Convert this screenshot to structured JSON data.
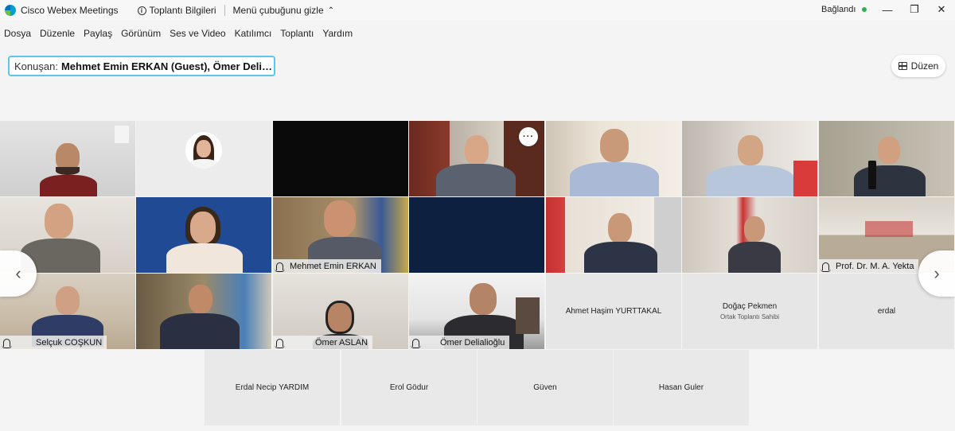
{
  "window": {
    "app_title": "Cisco Webex Meetings",
    "meeting_info": "Toplantı Bilgileri",
    "hide_menu": "Menü çubuğunu gizle",
    "status": "Bağlandı",
    "status_color": "#2bb24c"
  },
  "menu": [
    "Dosya",
    "Düzenle",
    "Paylaş",
    "Görünüm",
    "Ses ve Video",
    "Katılımcı",
    "Toplantı",
    "Yardım"
  ],
  "speaker": {
    "label": "Konuşan:",
    "names": "Mehmet Emin ERKAN (Guest), Ömer Delia..."
  },
  "layout_button": "Düzen",
  "participants": {
    "mehmet": "Mehmet Emin ERKAN",
    "yektai": "Prof. Dr. M. A. Yekta",
    "selcuk": "Selçuk COŞKUN",
    "omer_aslan": "Ömer ASLAN",
    "omer_d": "Ömer Delialioğlu",
    "ahmet": "Ahmet Haşim YURTTAKAL",
    "dogac": "Doğaç Pekmen",
    "dogac_role": "Ortak Toplantı Sahibi",
    "erdal": "erdal",
    "erdal_necip": "Erdal Necip YARDIM",
    "erol": "Erol Gödur",
    "guven": "Güven",
    "hasan": "Hasan Guler"
  },
  "colors": {
    "accent": "#5ec4ea"
  }
}
